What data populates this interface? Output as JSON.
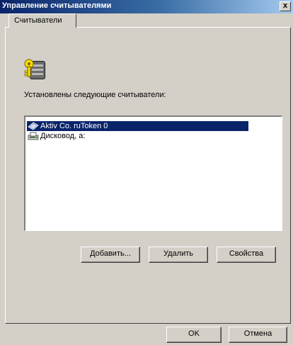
{
  "window": {
    "title": "Управление считывателями",
    "close_glyph": "x"
  },
  "tab": {
    "label": "Считыватели"
  },
  "panel": {
    "installed_label": "Установлены следующие считыватели:",
    "readers": [
      {
        "label": "Aktiv Co. ruToken 0",
        "icon": "token-reader-icon",
        "selected": true
      },
      {
        "label": "Дисковод, a:",
        "icon": "floppy-drive-icon",
        "selected": false
      }
    ],
    "buttons": {
      "add_label": "Добавить...",
      "remove_label": "Удалить",
      "properties_label": "Свойства"
    }
  },
  "dialog_buttons": {
    "ok_label": "OK",
    "cancel_label": "Отмена"
  },
  "colors": {
    "title_gradient_start": "#0a246a",
    "title_gradient_end": "#a6caf0",
    "selection": "#0a246a",
    "face": "#d4d0c8"
  }
}
